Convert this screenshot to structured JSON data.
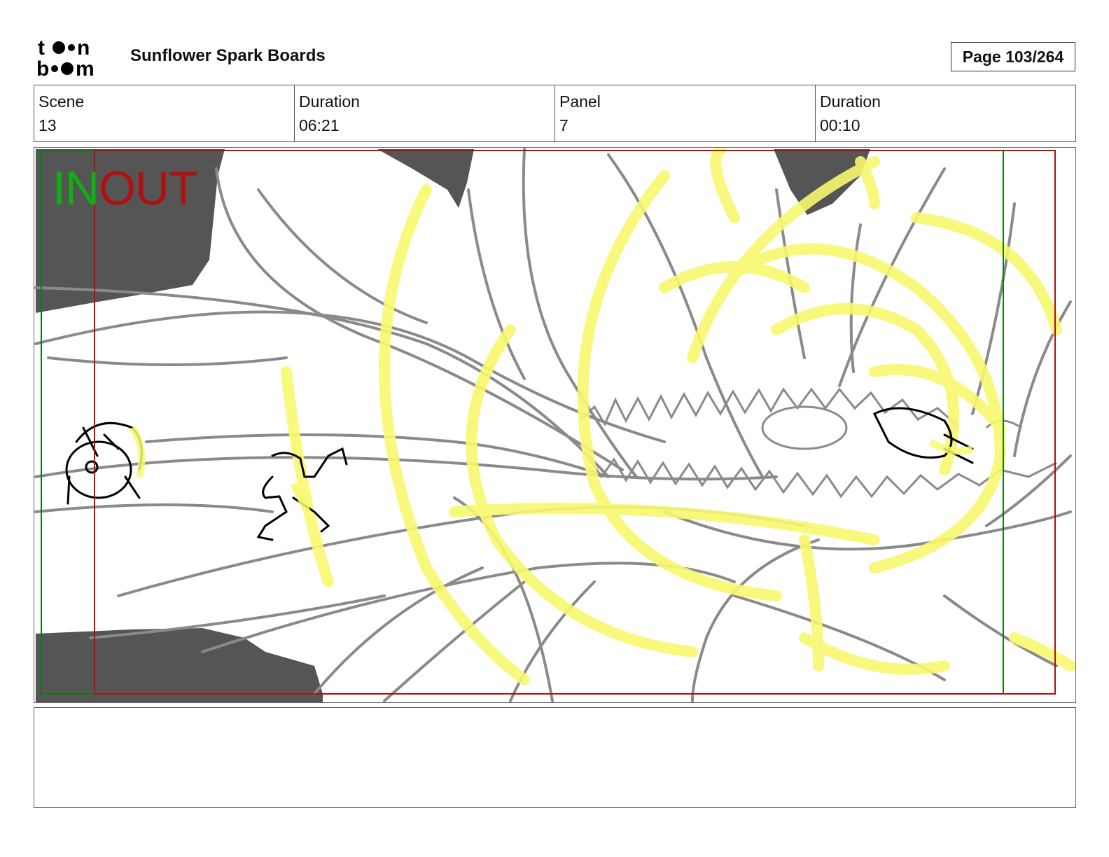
{
  "header": {
    "logo_text": "toon boom",
    "project_title": "Sunflower Spark Boards",
    "page_label": "Page 103/264"
  },
  "info": [
    {
      "label": "Scene",
      "value": "13"
    },
    {
      "label": "Duration",
      "value": "06:21"
    },
    {
      "label": "Panel",
      "value": "7"
    },
    {
      "label": "Duration",
      "value": "00:10"
    }
  ],
  "frame": {
    "in_label": "IN",
    "out_label": "OUT",
    "in_color": "#10b010",
    "out_color": "#b01010"
  },
  "notes": {
    "text": ""
  }
}
